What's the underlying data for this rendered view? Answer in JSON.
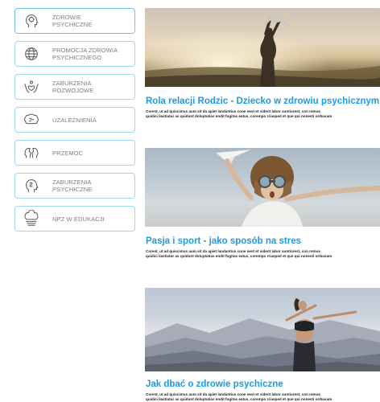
{
  "sidebar": {
    "items": [
      {
        "label": "ZDROWIE\nPSYCHICZNE",
        "icon": "head-brain-icon"
      },
      {
        "label": "PROMOCJA ZDROWIA\nPSYCHICZNEGO",
        "icon": "globe-icon"
      },
      {
        "label": "ZABURZENIA\nROZWOJOWE",
        "icon": "hands-heart-icon"
      },
      {
        "label": "UZALEŻNIENIA",
        "icon": "brain-icon"
      },
      {
        "label": "PRZEMOC",
        "icon": "broken-heads-icon"
      },
      {
        "label": "ZABURZENIA\nPSYCHICZNE",
        "icon": "head-mind-icon"
      },
      {
        "label": "NPZ W EDUKACJI",
        "icon": "brain-books-icon"
      }
    ]
  },
  "articles": [
    {
      "title": "Rola relacji Rodzic - Dziecko w zdrowiu psychicznym",
      "text_line1": "Corest, ut ad quiscimus aum sit da apiet landantius cone nest et vident labor suntiorest, con remos",
      "text_line2": "quidici liastiatur as quidunt doluptatias endit fugitas eatus, corempo rriasped et que qui nonesti oribusam"
    },
    {
      "title": "Pasja i sport - jako sposób na stres",
      "text_line1": "Corest, ut ad quiscimus aum sit da apiet landantius cone nest et vident labor suntiorest, con remos",
      "text_line2": "quidici liastiatur as quidunt doluptatias endit fugitas eatus, corempo rriasped et que qui nonesti oribusam"
    },
    {
      "title": "Jak dbać o zdrowie psychiczne",
      "text_line1": "Corest, ut ad quiscimus aum sit da apiet landantius cone nest et vident labor suntiorest, con remos",
      "text_line2": "quidici liastiatur as quidunt doluptatias endit fugitas eatus, corempo rriasped et que qui nonesti oribusam"
    }
  ],
  "colors": {
    "accent": "#1b9be0",
    "sidebar_border": "#9fd6f2",
    "sidebar_text": "#7a7f84"
  }
}
